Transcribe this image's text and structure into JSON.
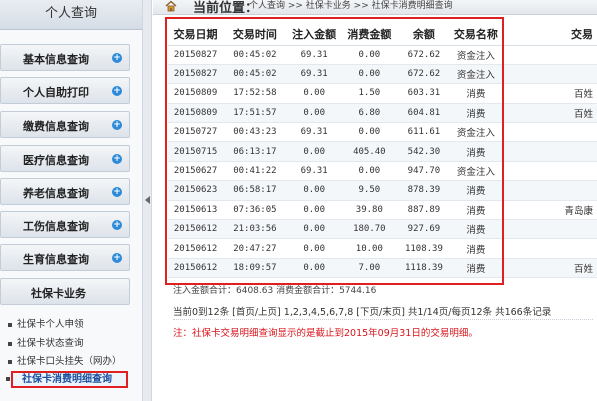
{
  "sidebar": {
    "title": "个人查询",
    "menu": [
      {
        "label": "基本信息查询"
      },
      {
        "label": "个人自助打印"
      },
      {
        "label": "缴费信息查询"
      },
      {
        "label": "医疗信息查询"
      },
      {
        "label": "养老信息查询"
      },
      {
        "label": "工伤信息查询"
      },
      {
        "label": "生育信息查询"
      },
      {
        "label": "社保卡业务"
      }
    ],
    "submenu": [
      {
        "label": "社保卡个人申领"
      },
      {
        "label": "社保卡状态查询"
      },
      {
        "label": "社保卡口头挂失（网办）"
      }
    ],
    "active_submenu": "社保卡消费明细查询"
  },
  "breadcrumb": {
    "label": "当前位置：",
    "path": "个人查询 >> 社保卡业务 >> 社保卡消费明细查询"
  },
  "table": {
    "headers": [
      "交易日期",
      "交易时间",
      "注入金额",
      "消费金额",
      "余额",
      "交易名称",
      "交易"
    ],
    "rows": [
      [
        "20150827",
        "00:45:02",
        "69.31",
        "0.00",
        "672.62",
        "资金注入",
        ""
      ],
      [
        "20150827",
        "00:45:02",
        "69.31",
        "0.00",
        "672.62",
        "资金注入",
        ""
      ],
      [
        "20150809",
        "17:52:58",
        "0.00",
        "1.50",
        "603.31",
        "消费",
        "百姓"
      ],
      [
        "20150809",
        "17:51:57",
        "0.00",
        "6.80",
        "604.81",
        "消费",
        "百姓"
      ],
      [
        "20150727",
        "00:43:23",
        "69.31",
        "0.00",
        "611.61",
        "资金注入",
        ""
      ],
      [
        "20150715",
        "06:13:17",
        "0.00",
        "405.40",
        "542.30",
        "消费",
        ""
      ],
      [
        "20150627",
        "00:41:22",
        "69.31",
        "0.00",
        "947.70",
        "资金注入",
        ""
      ],
      [
        "20150623",
        "06:58:17",
        "0.00",
        "9.50",
        "878.39",
        "消费",
        ""
      ],
      [
        "20150613",
        "07:36:05",
        "0.00",
        "39.80",
        "887.89",
        "消费",
        "青岛康"
      ],
      [
        "20150612",
        "21:03:56",
        "0.00",
        "180.70",
        "927.69",
        "消费",
        ""
      ],
      [
        "20150612",
        "20:47:27",
        "0.00",
        "10.00",
        "1108.39",
        "消费",
        ""
      ],
      [
        "20150612",
        "18:09:57",
        "0.00",
        "7.00",
        "1118.39",
        "消费",
        "百姓"
      ]
    ]
  },
  "summary": "注入金额合计：6408.63    消费金额合计：5744.16",
  "pager": "当前0到12条 [首页/上页] 1,2,3,4,5,6,7,8 [下页/末页] 共1/14页/每页12条 共166条记录",
  "note": "注：社保卡交易明细查询显示的是截止到2015年09月31日的交易明细。",
  "colors": {
    "accent": "#2c8ad8",
    "highlight": "#e02020",
    "note": "#d9141b"
  },
  "icons": [
    "home-icon",
    "plus-icon",
    "bullet-icon",
    "collapse-arrow-icon"
  ]
}
